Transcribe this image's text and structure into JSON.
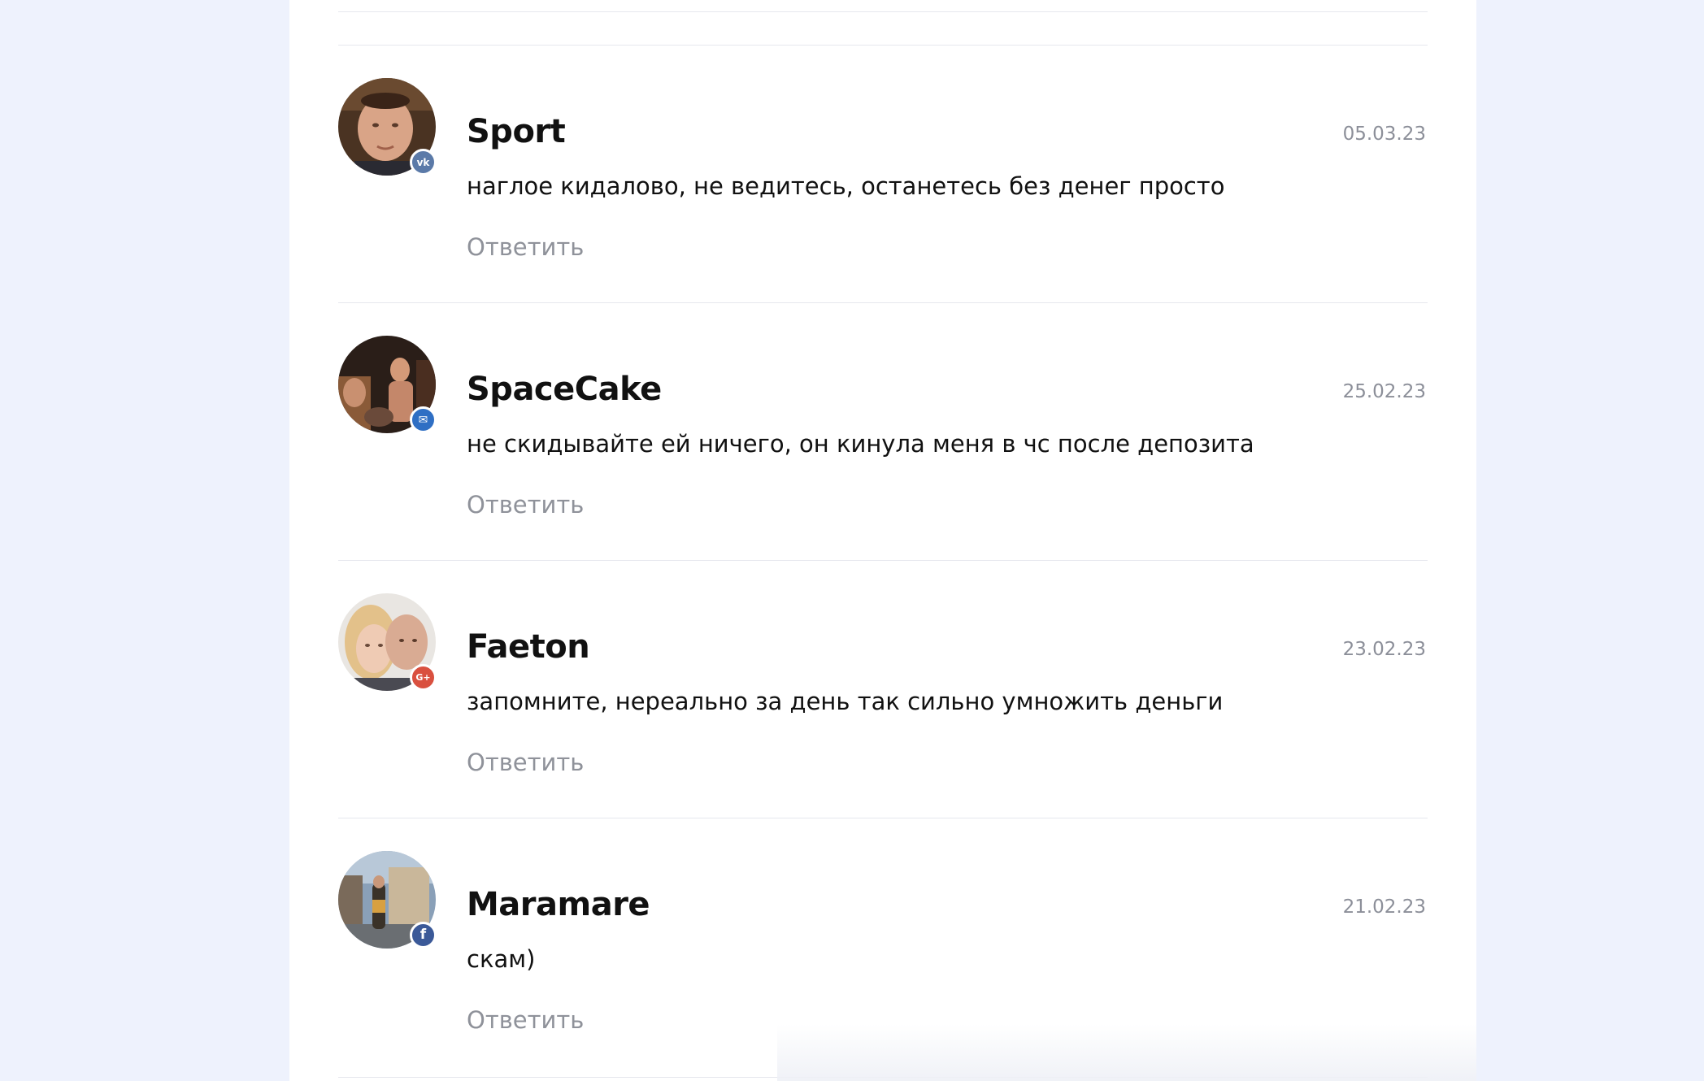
{
  "comments": [
    {
      "author": "Sport",
      "date": "05.03.23",
      "text": "наглое кидалово, не ведитесь, останетесь без денег просто",
      "reply_label": "Ответить",
      "social_network": "vk",
      "badge_glyph": "vk",
      "badge_color": "#5b7aa8"
    },
    {
      "author": "SpaceCake",
      "date": "25.02.23",
      "text": "не скидывайте ей ничего, он кинула меня в чс после депозита",
      "reply_label": "Ответить",
      "social_network": "mail",
      "badge_glyph": "✉",
      "badge_color": "#2f6fc4"
    },
    {
      "author": "Faeton",
      "date": "23.02.23",
      "text": "запомните, нереально за день так сильно умножить деньги",
      "reply_label": "Ответить",
      "social_network": "google-plus",
      "badge_glyph": "G+",
      "badge_color": "#d9503f"
    },
    {
      "author": "Maramare",
      "date": "21.02.23",
      "text": "скам)",
      "reply_label": "Ответить",
      "social_network": "facebook",
      "badge_glyph": "f",
      "badge_color": "#3b5998"
    }
  ]
}
